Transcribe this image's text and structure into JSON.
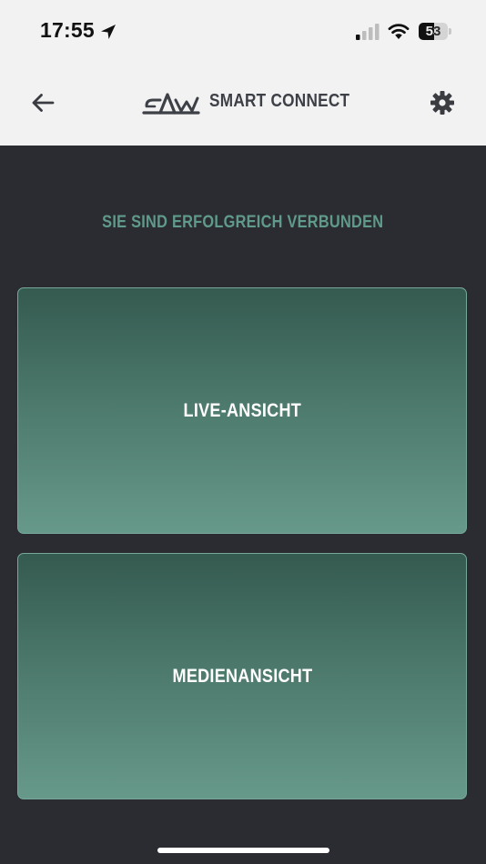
{
  "status_bar": {
    "time": "17:55",
    "battery_level": "53",
    "battery_fraction": 0.53,
    "icons": [
      "location-arrow-icon",
      "cellular-signal-icon",
      "wifi-icon",
      "battery-icon"
    ]
  },
  "header": {
    "title": "SMART CONNECT",
    "back_icon": "arrow-left-icon",
    "logo_icon": "brand-logo-icon",
    "settings_icon": "gear-icon"
  },
  "main": {
    "status_message": "SIE SIND ERFOLGREICH VERBUNDEN",
    "cards": [
      {
        "label": "LIVE-ANSICHT"
      },
      {
        "label": "MEDIENANSICHT"
      }
    ]
  },
  "colors": {
    "header_bg": "#f2f2f2",
    "page_bg": "#2b2c31",
    "accent_teal": "#5f9a8a",
    "card_top": "#355a50",
    "card_bottom": "#67998a",
    "card_border": "#77a99a"
  }
}
